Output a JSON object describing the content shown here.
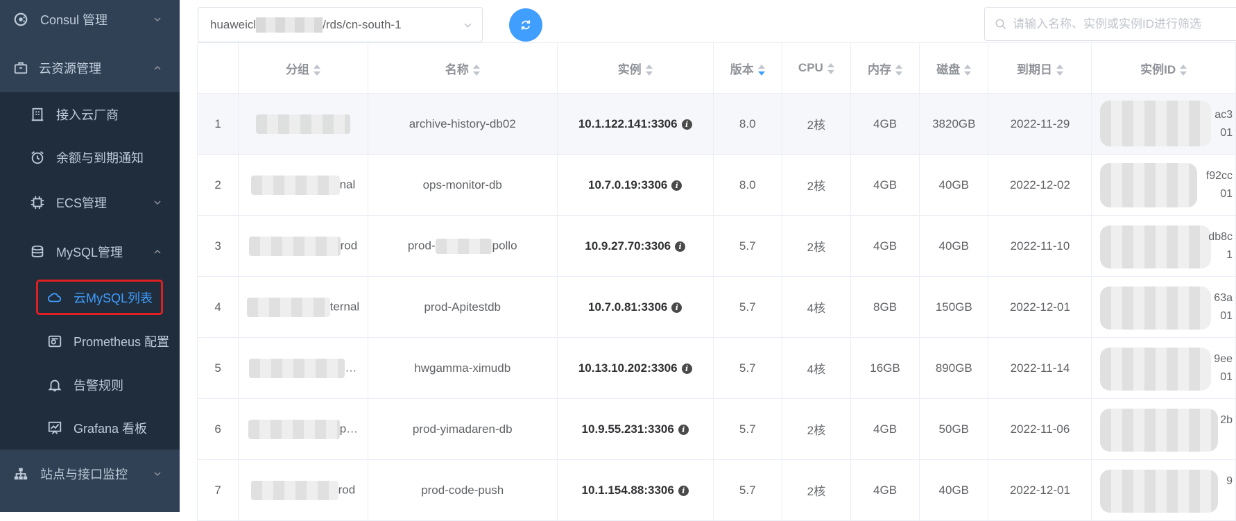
{
  "sidebar": {
    "items": [
      {
        "label": "Consul 管理",
        "icon": "consul-icon"
      },
      {
        "label": "云资源管理",
        "icon": "briefcase-icon"
      },
      {
        "label": "接入云厂商",
        "icon": "building-icon"
      },
      {
        "label": "余额与到期通知",
        "icon": "alarm-clock-icon"
      },
      {
        "label": "ECS管理",
        "icon": "chip-icon"
      },
      {
        "label": "MySQL管理",
        "icon": "database-icon"
      },
      {
        "label": "云MySQL列表",
        "icon": "cloud-icon"
      },
      {
        "label": "Prometheus 配置",
        "icon": "settings-panel-icon"
      },
      {
        "label": "告警规则",
        "icon": "bell-icon"
      },
      {
        "label": "Grafana 看板",
        "icon": "dashboard-icon"
      },
      {
        "label": "站点与接口监控",
        "icon": "sitemap-icon"
      }
    ],
    "active_color": "#409eff"
  },
  "toolbar": {
    "select_prefix": "huaweicl",
    "select_suffix": "/rds/cn-south-1",
    "search_placeholder": "请输入名称、实例或实例ID进行筛选"
  },
  "table": {
    "headers": {
      "group": "分组",
      "name": "名称",
      "instance": "实例",
      "version": "版本",
      "cpu": "CPU",
      "memory": "内存",
      "disk": "磁盘",
      "expire": "到期日",
      "instance_id": "实例ID"
    },
    "rows": [
      {
        "idx": "1",
        "group_tail": "",
        "name": "archive-history-db02",
        "instance": "10.1.122.141:3306",
        "version": "8.0",
        "cpu": "2核",
        "memory": "4GB",
        "disk": "3820GB",
        "expire": "2022-11-29",
        "id_tail_1": "ac3",
        "id_tail_2": "01"
      },
      {
        "idx": "2",
        "group_tail": "nal",
        "name": "ops-monitor-db",
        "instance": "10.7.0.19:3306",
        "version": "8.0",
        "cpu": "2核",
        "memory": "4GB",
        "disk": "40GB",
        "expire": "2022-12-02",
        "id_tail_1": "f92cc",
        "id_tail_2": "01"
      },
      {
        "idx": "3",
        "group_tail": "rod",
        "name_prefix": "prod-",
        "name_suffix": "pollo",
        "instance": "10.9.27.70:3306",
        "version": "5.7",
        "cpu": "2核",
        "memory": "4GB",
        "disk": "40GB",
        "expire": "2022-11-10",
        "id_tail_1": "db8c",
        "id_tail_2": "1"
      },
      {
        "idx": "4",
        "group_tail": "ternal",
        "name": "prod-Apitestdb",
        "instance": "10.7.0.81:3306",
        "version": "5.7",
        "cpu": "4核",
        "memory": "8GB",
        "disk": "150GB",
        "expire": "2022-12-01",
        "id_tail_1": "63a",
        "id_tail_2": "01"
      },
      {
        "idx": "5",
        "group_tail": "…",
        "name": "hwgamma-ximudb",
        "instance": "10.13.10.202:3306",
        "version": "5.7",
        "cpu": "4核",
        "memory": "16GB",
        "disk": "890GB",
        "expire": "2022-11-14",
        "id_tail_1": "9ee",
        "id_tail_2": "01"
      },
      {
        "idx": "6",
        "group_tail": "p…",
        "name": "prod-yimadaren-db",
        "instance": "10.9.55.231:3306",
        "version": "5.7",
        "cpu": "2核",
        "memory": "4GB",
        "disk": "50GB",
        "expire": "2022-11-06",
        "id_tail_1": "2b",
        "id_tail_2": ""
      },
      {
        "idx": "7",
        "group_tail": "rod",
        "name": "prod-code-push",
        "instance": "10.1.154.88:3306",
        "version": "5.7",
        "cpu": "2核",
        "memory": "4GB",
        "disk": "40GB",
        "expire": "2022-12-01",
        "id_tail_1": "9",
        "id_tail_2": ""
      }
    ]
  }
}
